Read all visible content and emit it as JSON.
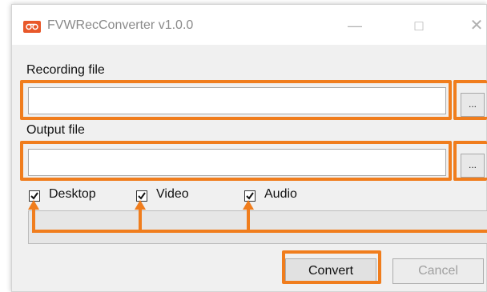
{
  "window": {
    "title": "FVWRecConverter v1.0.0",
    "icons": {
      "app": "app-logo-icon",
      "minimize": "minimize-icon",
      "maximize": "maximize-icon",
      "close": "close-icon"
    },
    "controls": {
      "minimize": "—",
      "maximize": "□",
      "close": "✕"
    }
  },
  "recording": {
    "label": "Recording file",
    "value": "",
    "browse_label": "..."
  },
  "output": {
    "label": "Output file",
    "value": "",
    "browse_label": "..."
  },
  "options": [
    {
      "label": "Desktop",
      "checked": true
    },
    {
      "label": "Video",
      "checked": true
    },
    {
      "label": "Audio",
      "checked": true
    }
  ],
  "progress": {
    "value": 0
  },
  "buttons": {
    "convert": "Convert",
    "cancel": "Cancel"
  },
  "colors": {
    "highlight": "#f07d1d",
    "app_icon": "#e8582a"
  }
}
